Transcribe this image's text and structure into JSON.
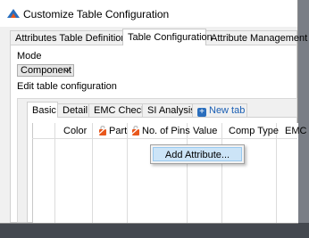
{
  "window": {
    "title": "Customize Table Configuration",
    "icon": "app-triangle-icon"
  },
  "outer_tabs": [
    {
      "label": "Attributes Table Definition File",
      "active": false
    },
    {
      "label": "Table Configuration",
      "active": true
    },
    {
      "label": "Attribute Management",
      "active": false
    }
  ],
  "mode": {
    "label": "Mode",
    "selected": "Component"
  },
  "edit_label": "Edit table configuration",
  "inner_tabs": [
    {
      "label": "Basic",
      "active": true
    },
    {
      "label": "Detail",
      "active": false
    },
    {
      "label": "EMC Check",
      "active": false
    },
    {
      "label": "SI Analysis",
      "active": false
    },
    {
      "label": "New tab",
      "active": false,
      "icon": "plus-icon"
    }
  ],
  "columns": [
    {
      "label": "Color",
      "locked": false
    },
    {
      "label": "Part",
      "locked": true
    },
    {
      "label": "No. of Pins",
      "locked": true
    },
    {
      "label": "Value",
      "locked": false
    },
    {
      "label": "Comp Type",
      "locked": false
    },
    {
      "label": "EMC Pa",
      "locked": false
    }
  ],
  "context_menu": {
    "items": [
      "Add Attribute..."
    ]
  },
  "colors": {
    "accent": "#2a6ebd",
    "menu_highlight": "#cce4f7",
    "lock": "#e8571c"
  }
}
